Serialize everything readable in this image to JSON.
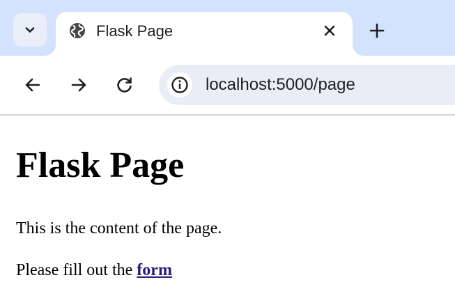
{
  "browser": {
    "tab": {
      "title": "Flask Page",
      "favicon": "globe-icon"
    },
    "tab_menu_icon": "chevron-down-icon",
    "tab_close_icon": "close-icon",
    "new_tab_icon": "plus-icon",
    "toolbar": {
      "back_icon": "arrow-left-icon",
      "forward_icon": "arrow-right-icon",
      "reload_icon": "reload-icon",
      "site_info_icon": "info-icon",
      "url": "localhost:5000/page"
    },
    "colors": {
      "tabstrip_bg": "#d3e3fd",
      "omnibox_bg": "#e9eef6",
      "link": "#2b1a7a"
    }
  },
  "page": {
    "heading": "Flask Page",
    "paragraph1": "This is the content of the page.",
    "paragraph2_prefix": "Please fill out the ",
    "form_link": "form"
  }
}
